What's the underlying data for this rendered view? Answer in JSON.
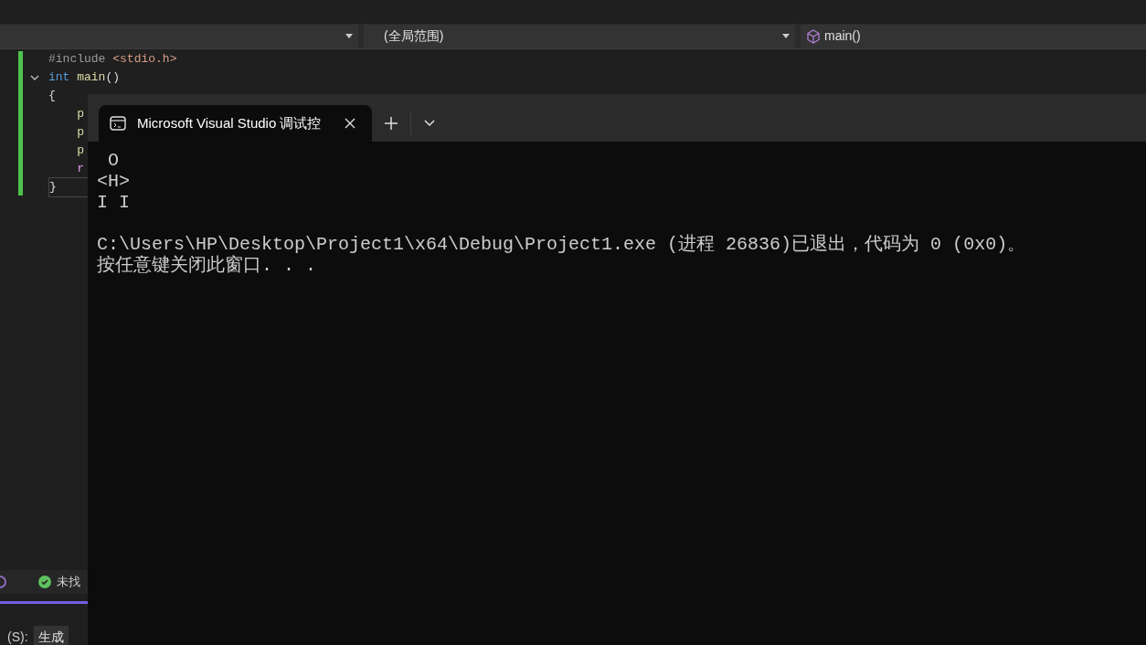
{
  "ide": {
    "nav_bar": {
      "scope_dropdown": {
        "value": "(全局范围)"
      },
      "member_dropdown": {
        "value": "main()"
      }
    },
    "code_lines": [
      {
        "tokens": [
          {
            "kind": "preproc",
            "text": "#include"
          },
          {
            "kind": "string",
            "text": " <stdio.h>"
          }
        ]
      },
      {
        "expanded": true,
        "tokens": [
          {
            "kind": "keyword",
            "text": "int"
          },
          {
            "kind": "function",
            "text": " main"
          },
          {
            "kind": "plain",
            "text": "()"
          }
        ]
      },
      {
        "tokens": [
          {
            "kind": "plain",
            "text": "{"
          }
        ]
      },
      {
        "tokens": [
          {
            "kind": "function",
            "text": "    p"
          }
        ]
      },
      {
        "tokens": [
          {
            "kind": "function",
            "text": "    p"
          }
        ]
      },
      {
        "tokens": [
          {
            "kind": "function",
            "text": "    p"
          }
        ]
      },
      {
        "tokens": [
          {
            "kind": "control",
            "text": "    r"
          }
        ]
      },
      {
        "current": true,
        "tokens": [
          {
            "kind": "plain",
            "text": "}"
          }
        ]
      }
    ],
    "status_row": {
      "message": "未找"
    },
    "output_row": {
      "label": "(S):",
      "value": "生成"
    }
  },
  "terminal": {
    "tabs": [
      {
        "title": "Microsoft Visual Studio 调试控",
        "selected": true
      }
    ],
    "blocks": [
      [
        " O",
        "<H>",
        "I I"
      ],
      [
        "C:\\Users\\HP\\Desktop\\Project1\\x64\\Debug\\Project1.exe (进程 26836)已退出，代码为 0 (0x0)。",
        "按任意键关闭此窗口. . ."
      ]
    ]
  }
}
